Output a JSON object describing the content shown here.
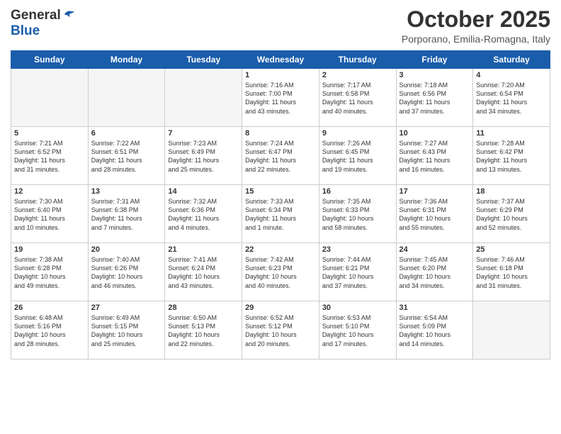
{
  "header": {
    "logo_general": "General",
    "logo_blue": "Blue",
    "month_title": "October 2025",
    "location": "Porporano, Emilia-Romagna, Italy"
  },
  "days_of_week": [
    "Sunday",
    "Monday",
    "Tuesday",
    "Wednesday",
    "Thursday",
    "Friday",
    "Saturday"
  ],
  "weeks": [
    [
      {
        "day": "",
        "info": ""
      },
      {
        "day": "",
        "info": ""
      },
      {
        "day": "",
        "info": ""
      },
      {
        "day": "1",
        "info": "Sunrise: 7:16 AM\nSunset: 7:00 PM\nDaylight: 11 hours\nand 43 minutes."
      },
      {
        "day": "2",
        "info": "Sunrise: 7:17 AM\nSunset: 6:58 PM\nDaylight: 11 hours\nand 40 minutes."
      },
      {
        "day": "3",
        "info": "Sunrise: 7:18 AM\nSunset: 6:56 PM\nDaylight: 11 hours\nand 37 minutes."
      },
      {
        "day": "4",
        "info": "Sunrise: 7:20 AM\nSunset: 6:54 PM\nDaylight: 11 hours\nand 34 minutes."
      }
    ],
    [
      {
        "day": "5",
        "info": "Sunrise: 7:21 AM\nSunset: 6:52 PM\nDaylight: 11 hours\nand 31 minutes."
      },
      {
        "day": "6",
        "info": "Sunrise: 7:22 AM\nSunset: 6:51 PM\nDaylight: 11 hours\nand 28 minutes."
      },
      {
        "day": "7",
        "info": "Sunrise: 7:23 AM\nSunset: 6:49 PM\nDaylight: 11 hours\nand 25 minutes."
      },
      {
        "day": "8",
        "info": "Sunrise: 7:24 AM\nSunset: 6:47 PM\nDaylight: 11 hours\nand 22 minutes."
      },
      {
        "day": "9",
        "info": "Sunrise: 7:26 AM\nSunset: 6:45 PM\nDaylight: 11 hours\nand 19 minutes."
      },
      {
        "day": "10",
        "info": "Sunrise: 7:27 AM\nSunset: 6:43 PM\nDaylight: 11 hours\nand 16 minutes."
      },
      {
        "day": "11",
        "info": "Sunrise: 7:28 AM\nSunset: 6:42 PM\nDaylight: 11 hours\nand 13 minutes."
      }
    ],
    [
      {
        "day": "12",
        "info": "Sunrise: 7:30 AM\nSunset: 6:40 PM\nDaylight: 11 hours\nand 10 minutes."
      },
      {
        "day": "13",
        "info": "Sunrise: 7:31 AM\nSunset: 6:38 PM\nDaylight: 11 hours\nand 7 minutes."
      },
      {
        "day": "14",
        "info": "Sunrise: 7:32 AM\nSunset: 6:36 PM\nDaylight: 11 hours\nand 4 minutes."
      },
      {
        "day": "15",
        "info": "Sunrise: 7:33 AM\nSunset: 6:34 PM\nDaylight: 11 hours\nand 1 minute."
      },
      {
        "day": "16",
        "info": "Sunrise: 7:35 AM\nSunset: 6:33 PM\nDaylight: 10 hours\nand 58 minutes."
      },
      {
        "day": "17",
        "info": "Sunrise: 7:36 AM\nSunset: 6:31 PM\nDaylight: 10 hours\nand 55 minutes."
      },
      {
        "day": "18",
        "info": "Sunrise: 7:37 AM\nSunset: 6:29 PM\nDaylight: 10 hours\nand 52 minutes."
      }
    ],
    [
      {
        "day": "19",
        "info": "Sunrise: 7:38 AM\nSunset: 6:28 PM\nDaylight: 10 hours\nand 49 minutes."
      },
      {
        "day": "20",
        "info": "Sunrise: 7:40 AM\nSunset: 6:26 PM\nDaylight: 10 hours\nand 46 minutes."
      },
      {
        "day": "21",
        "info": "Sunrise: 7:41 AM\nSunset: 6:24 PM\nDaylight: 10 hours\nand 43 minutes."
      },
      {
        "day": "22",
        "info": "Sunrise: 7:42 AM\nSunset: 6:23 PM\nDaylight: 10 hours\nand 40 minutes."
      },
      {
        "day": "23",
        "info": "Sunrise: 7:44 AM\nSunset: 6:21 PM\nDaylight: 10 hours\nand 37 minutes."
      },
      {
        "day": "24",
        "info": "Sunrise: 7:45 AM\nSunset: 6:20 PM\nDaylight: 10 hours\nand 34 minutes."
      },
      {
        "day": "25",
        "info": "Sunrise: 7:46 AM\nSunset: 6:18 PM\nDaylight: 10 hours\nand 31 minutes."
      }
    ],
    [
      {
        "day": "26",
        "info": "Sunrise: 6:48 AM\nSunset: 5:16 PM\nDaylight: 10 hours\nand 28 minutes."
      },
      {
        "day": "27",
        "info": "Sunrise: 6:49 AM\nSunset: 5:15 PM\nDaylight: 10 hours\nand 25 minutes."
      },
      {
        "day": "28",
        "info": "Sunrise: 6:50 AM\nSunset: 5:13 PM\nDaylight: 10 hours\nand 22 minutes."
      },
      {
        "day": "29",
        "info": "Sunrise: 6:52 AM\nSunset: 5:12 PM\nDaylight: 10 hours\nand 20 minutes."
      },
      {
        "day": "30",
        "info": "Sunrise: 6:53 AM\nSunset: 5:10 PM\nDaylight: 10 hours\nand 17 minutes."
      },
      {
        "day": "31",
        "info": "Sunrise: 6:54 AM\nSunset: 5:09 PM\nDaylight: 10 hours\nand 14 minutes."
      },
      {
        "day": "",
        "info": ""
      }
    ]
  ]
}
